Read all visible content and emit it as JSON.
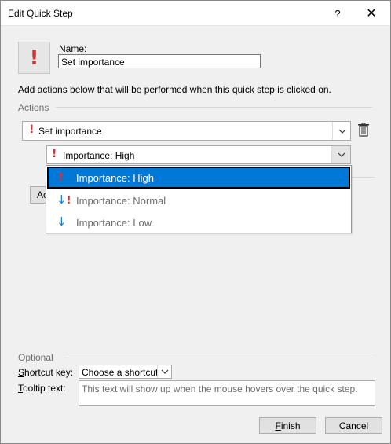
{
  "window": {
    "title": "Edit Quick Step",
    "help_label": "?",
    "close_label": "✕"
  },
  "header": {
    "name_label_accel": "N",
    "name_label_rest": "ame:",
    "name_value": "Set importance"
  },
  "description": "Add actions below that will be performed when this quick step is clicked on.",
  "actions": {
    "group_label": "Actions",
    "action_selected": "Set importance",
    "importance_selected": "Importance: High",
    "add_button_partial": "Ac",
    "dropdown_options": [
      {
        "label": "Importance: High",
        "icon": "exclamation-icon",
        "selected": true
      },
      {
        "label": "Importance: Normal",
        "icon": "normal-importance-icon",
        "selected": false
      },
      {
        "label": "Importance: Low",
        "icon": "down-arrow-icon",
        "selected": false
      }
    ]
  },
  "optional": {
    "group_label": "Optional",
    "shortcut_label_accel": "S",
    "shortcut_label_rest": "hortcut key:",
    "shortcut_value": "Choose a shortcut",
    "tooltip_label_accel": "T",
    "tooltip_label_rest": "ooltip text:",
    "tooltip_placeholder": "This text will show up when the mouse hovers over the quick step."
  },
  "footer": {
    "finish_accel": "F",
    "finish_rest": "inish",
    "cancel_label": "Cancel"
  },
  "colors": {
    "accent": "#0078d7",
    "importance_red": "#d13438",
    "low_arrow_blue": "#1e7dd0"
  }
}
